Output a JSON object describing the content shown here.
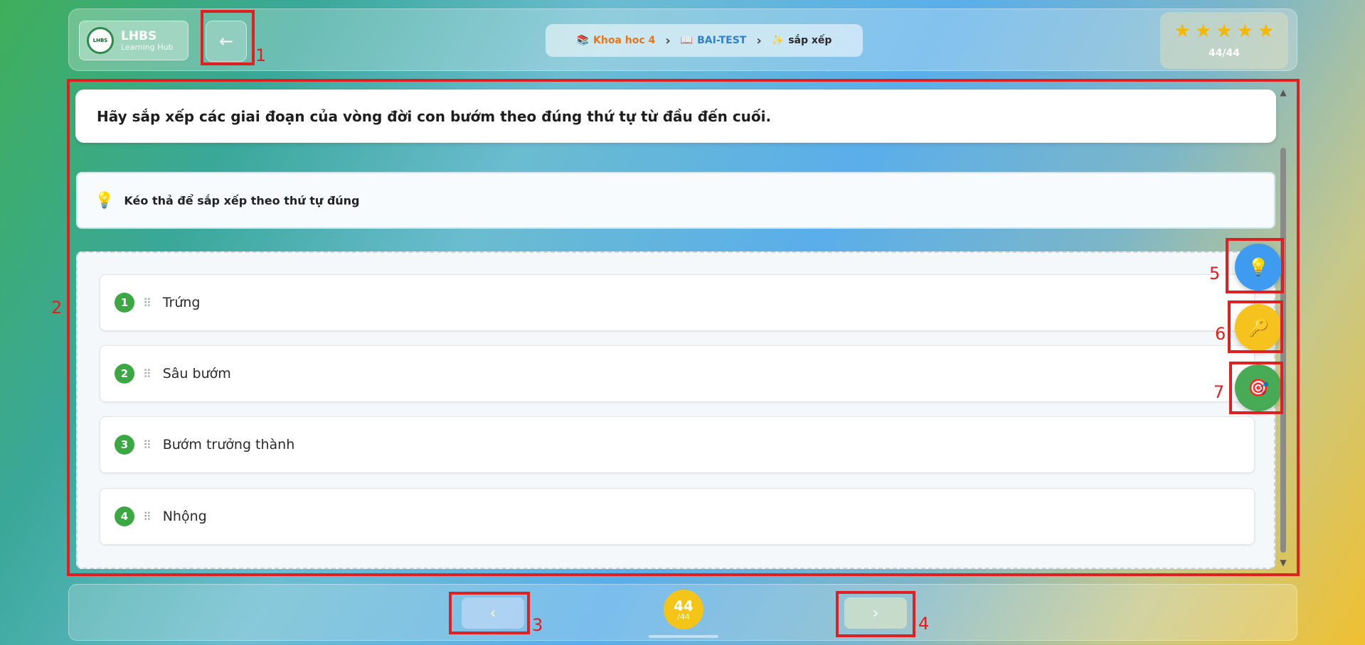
{
  "header": {
    "logo_title": "LHBS",
    "logo_subtitle": "Learning Hub",
    "logo_badge": "LHBS",
    "back_icon": "arrow-left-icon",
    "breadcrumb": [
      {
        "icon": "books-icon",
        "glyph": "📚",
        "label": "Khoa hoc 4"
      },
      {
        "icon": "book-icon",
        "glyph": "📖",
        "label": "BAI-TEST"
      },
      {
        "icon": "sparkles-icon",
        "glyph": "✨",
        "label": "sắp xếp"
      }
    ],
    "stars_count": "44/44",
    "star_rating": 5
  },
  "question": {
    "text": "Hãy sắp xếp các giai đoạn của vòng đời con bướm theo đúng thứ tự từ đầu đến cuối."
  },
  "instruction": {
    "text": "Kéo thả để sắp xếp theo thứ tự đúng"
  },
  "items": [
    {
      "number": "1",
      "label": "Trứng"
    },
    {
      "number": "2",
      "label": "Sâu bướm"
    },
    {
      "number": "3",
      "label": "Bướm trưởng thành"
    },
    {
      "number": "4",
      "label": "Nhộng"
    }
  ],
  "footer": {
    "page_current": "44",
    "page_total": "/44"
  },
  "annotations": [
    "1",
    "2",
    "3",
    "4",
    "5",
    "6",
    "7"
  ],
  "colors": {
    "accent_green": "#3ba844",
    "hint_blue": "#3e9bf0",
    "key_yellow": "#f6c21e",
    "annotation_red": "#e02020"
  }
}
